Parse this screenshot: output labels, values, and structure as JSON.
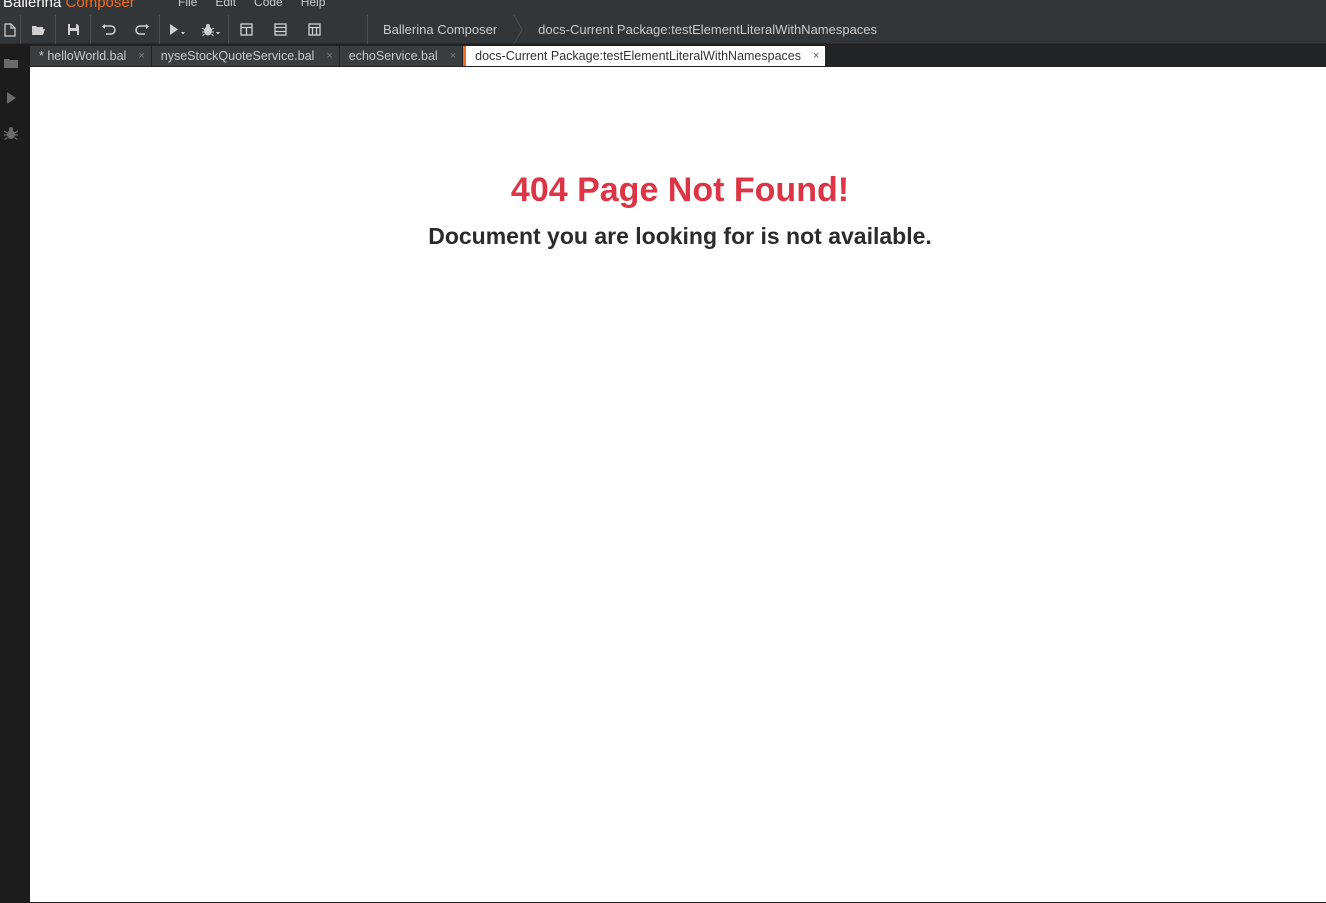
{
  "app": {
    "brand_main": "Ballerina",
    "brand_accent": "Composer",
    "accent_color": "#f26b22"
  },
  "menu": {
    "items": [
      "File",
      "Edit",
      "Code",
      "Help"
    ]
  },
  "toolbar": {
    "icons": [
      "new-file-icon",
      "open-folder-icon",
      "save-icon",
      "undo-icon",
      "redo-icon",
      "run-icon",
      "debug-icon",
      "layout-split-icon",
      "layout-full-icon",
      "layout-grid-icon"
    ]
  },
  "breadcrumb": {
    "items": [
      "Ballerina Composer",
      "docs-Current Package:testElementLiteralWithNamespaces"
    ]
  },
  "tabs": [
    {
      "label": "* helloWorld.bal",
      "active": false
    },
    {
      "label": "nyseStockQuoteService.bal",
      "active": false
    },
    {
      "label": "echoService.bal",
      "active": false
    },
    {
      "label": "docs-Current Package:testElementLiteralWithNamespaces",
      "active": true
    }
  ],
  "tab_close_glyph": "×",
  "content": {
    "title": "404 Page Not Found!",
    "subtitle": "Document you are looking for is not available.",
    "title_color": "#dc3545"
  }
}
